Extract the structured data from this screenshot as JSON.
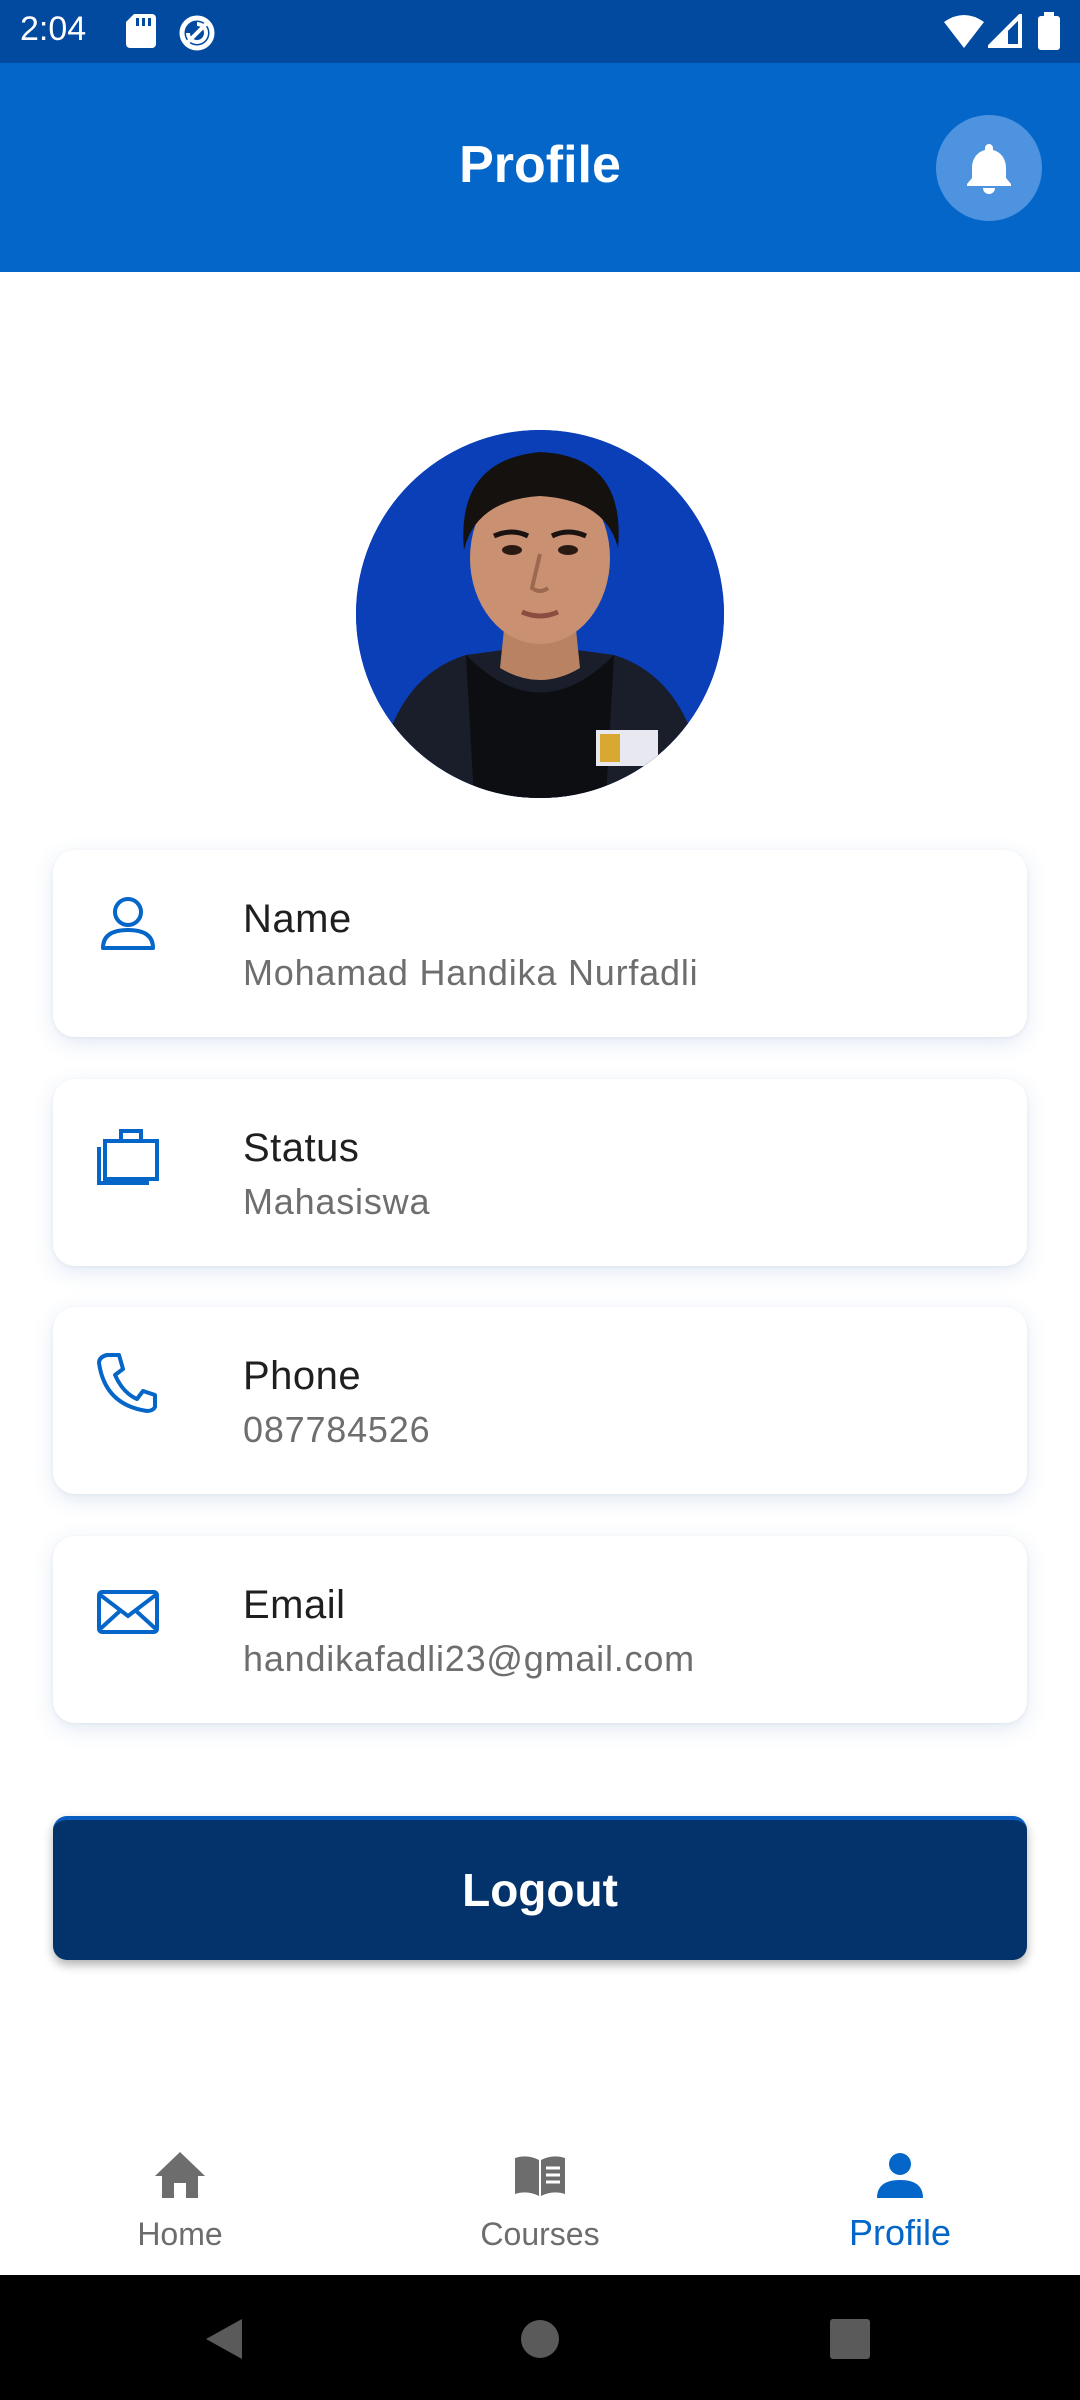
{
  "status_bar": {
    "time": "2:04"
  },
  "app_bar": {
    "title": "Profile"
  },
  "profile": {
    "fields": [
      {
        "label": "Name",
        "value": "Mohamad Handika Nurfadli",
        "icon": "person-icon"
      },
      {
        "label": "Status",
        "value": "Mahasiswa",
        "icon": "briefcase-icon"
      },
      {
        "label": "Phone",
        "value": "087784526",
        "icon": "phone-icon"
      },
      {
        "label": "Email",
        "value": "handikafadli23@gmail.com",
        "icon": "mail-icon"
      }
    ],
    "logout_label": "Logout"
  },
  "bottom_nav": {
    "items": [
      {
        "label": "Home",
        "icon": "home-icon",
        "active": false
      },
      {
        "label": "Courses",
        "icon": "book-icon",
        "active": false
      },
      {
        "label": "Profile",
        "icon": "person-icon",
        "active": true
      }
    ]
  },
  "colors": {
    "primary": "#0466c8",
    "status_bar": "#024aa0",
    "logout": "#04326a",
    "inactive_nav": "#6d6d6d"
  }
}
